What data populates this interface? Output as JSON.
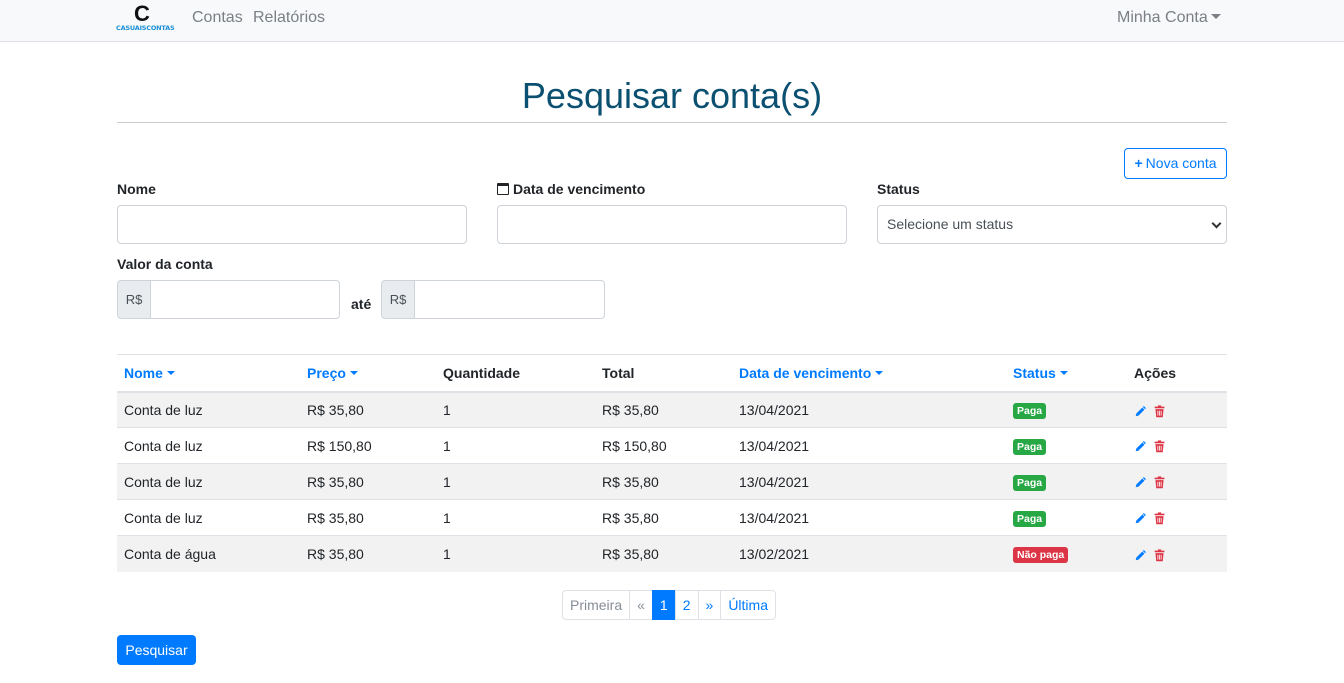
{
  "navbar": {
    "logo_glyph": "C",
    "logo_text": "CASUAISCONTAS",
    "links": [
      "Contas",
      "Relatórios"
    ],
    "account_label": "Minha Conta"
  },
  "page": {
    "title": "Pesquisar conta(s)",
    "new_button_label": "Nova conta"
  },
  "form": {
    "nome_label": "Nome",
    "nome_value": "",
    "data_label": "Data de vencimento",
    "data_value": "",
    "status_label": "Status",
    "status_selected": "Selecione um status",
    "valor_label": "Valor da conta",
    "currency_addon": "R$",
    "range_separator": "até",
    "valor_min": "",
    "valor_max": ""
  },
  "table": {
    "headers": [
      {
        "label": "Nome",
        "sortable": true
      },
      {
        "label": "Preço",
        "sortable": true
      },
      {
        "label": "Quantidade",
        "sortable": false
      },
      {
        "label": "Total",
        "sortable": false
      },
      {
        "label": "Data de vencimento",
        "sortable": true
      },
      {
        "label": "Status",
        "sortable": true
      },
      {
        "label": "Ações",
        "sortable": false
      }
    ],
    "rows": [
      {
        "nome": "Conta de luz",
        "preco": "R$ 35,80",
        "quantidade": "1",
        "total": "R$ 35,80",
        "vencimento": "13/04/2021",
        "status": "Paga",
        "status_type": "paga"
      },
      {
        "nome": "Conta de luz",
        "preco": "R$ 150,80",
        "quantidade": "1",
        "total": "R$ 150,80",
        "vencimento": "13/04/2021",
        "status": "Paga",
        "status_type": "paga"
      },
      {
        "nome": "Conta de luz",
        "preco": "R$ 35,80",
        "quantidade": "1",
        "total": "R$ 35,80",
        "vencimento": "13/04/2021",
        "status": "Paga",
        "status_type": "paga"
      },
      {
        "nome": "Conta de luz",
        "preco": "R$ 35,80",
        "quantidade": "1",
        "total": "R$ 35,80",
        "vencimento": "13/04/2021",
        "status": "Paga",
        "status_type": "paga"
      },
      {
        "nome": "Conta de água",
        "preco": "R$ 35,80",
        "quantidade": "1",
        "total": "R$ 35,80",
        "vencimento": "13/02/2021",
        "status": "Não paga",
        "status_type": "naopaga"
      }
    ]
  },
  "pagination": {
    "first": "Primeira",
    "prev": "«",
    "pages": [
      "1",
      "2"
    ],
    "current": "1",
    "next": "»",
    "last": "Última"
  },
  "search_button_label": "Pesquisar",
  "colors": {
    "primary": "#007bff",
    "title": "#0b5070",
    "success": "#28a745",
    "danger": "#dc3545"
  },
  "icons": {
    "edit": "pencil-icon",
    "delete": "trash-icon",
    "calendar": "calendar-icon",
    "plus": "plus-icon"
  }
}
